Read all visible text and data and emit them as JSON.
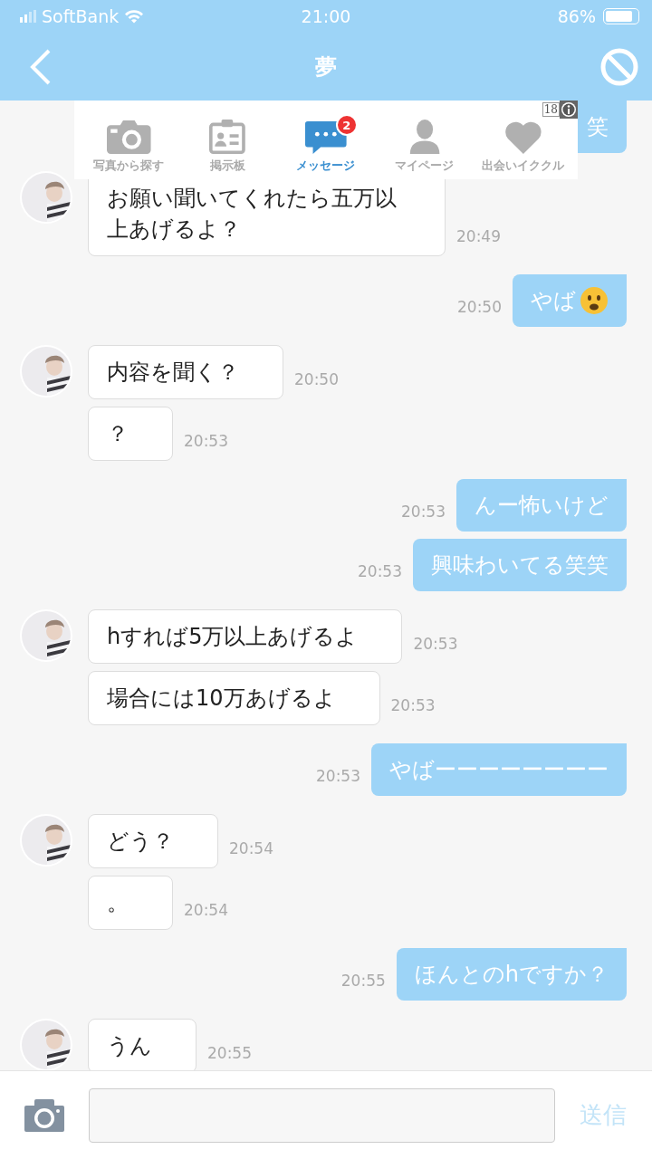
{
  "status_bar": {
    "carrier": "SoftBank",
    "time": "21:00",
    "battery": "86%"
  },
  "header": {
    "title": "夢"
  },
  "ad_tabs": {
    "age_label": "18",
    "items": [
      {
        "label": "写真から探す",
        "kind": "camera",
        "selected": false
      },
      {
        "label": "掲示板",
        "kind": "board",
        "selected": false
      },
      {
        "label": "メッセージ",
        "kind": "message",
        "selected": true,
        "badge": "2"
      },
      {
        "label": "マイページ",
        "kind": "person",
        "selected": false
      },
      {
        "label": "出会いイククル",
        "kind": "heart",
        "selected": false
      }
    ]
  },
  "messages": [
    {
      "kind": "outgoing",
      "text": "笑"
    },
    {
      "kind": "incoming",
      "text": "お願い聞いてくれたら五万以上あげるよ？",
      "time": "20:49"
    },
    {
      "kind": "outgoing_frown",
      "text": "やば",
      "time": "20:50"
    },
    {
      "kind": "incoming",
      "text": "内容を聞く？",
      "time": "20:50"
    },
    {
      "kind": "incoming",
      "text": "？",
      "time": "20:53"
    },
    {
      "kind": "outgoing",
      "text": "んー怖いけど",
      "time": "20:53"
    },
    {
      "kind": "outgoing",
      "text": "興味わいてる笑笑",
      "time": "20:53"
    },
    {
      "kind": "incoming",
      "text": "hすれば5万以上あげるよ",
      "time": "20:53"
    },
    {
      "kind": "incoming",
      "text": "場合には10万あげるよ",
      "time": "20:53"
    },
    {
      "kind": "outgoing",
      "text": "やばーーーーーーーー",
      "time": "20:53"
    },
    {
      "kind": "incoming",
      "text": "どう？",
      "time": "20:54"
    },
    {
      "kind": "incoming",
      "text": "。",
      "time": "20:54"
    },
    {
      "kind": "outgoing",
      "text": "ほんとのhですか？",
      "time": "20:55"
    },
    {
      "kind": "incoming",
      "text": "うん",
      "time": "20:55"
    }
  ],
  "composer": {
    "send_label": "送信",
    "send_disabled": true
  }
}
